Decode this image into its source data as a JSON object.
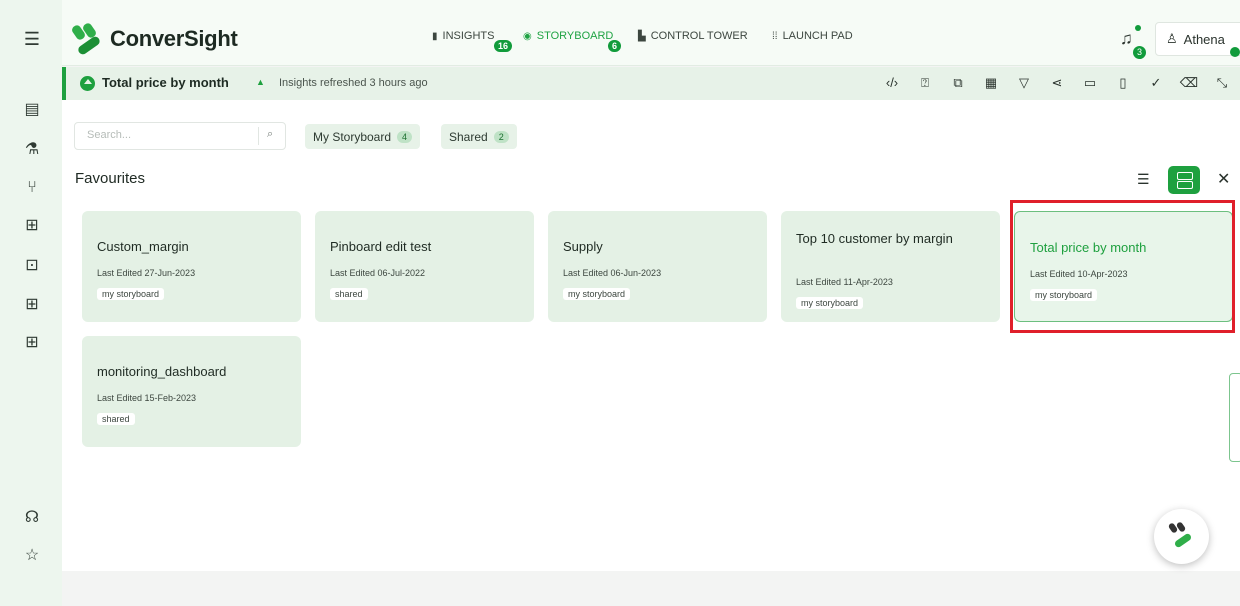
{
  "app": {
    "logo_text": "ConverSight"
  },
  "nav": {
    "items": [
      {
        "label": "INSIGHTS",
        "badge": "16",
        "icon": "bar-chart-icon"
      },
      {
        "label": "STORYBOARD",
        "badge": "6",
        "icon": "storyboard-icon"
      },
      {
        "label": "CONTROL TOWER",
        "icon": "tower-icon"
      },
      {
        "label": "LAUNCH PAD",
        "icon": "grid-icon"
      }
    ]
  },
  "notifications": {
    "count": "3"
  },
  "user": {
    "name": "Athena"
  },
  "storyboard": {
    "title": "Total price by month",
    "refresh": "Insights refreshed 3 hours ago",
    "tools": [
      "code-icon",
      "help-icon",
      "copy-icon",
      "layout-icon",
      "filter-icon",
      "share-icon",
      "calendar-icon",
      "document-icon",
      "check-icon",
      "delete-icon",
      "expand-icon"
    ]
  },
  "search": {
    "placeholder": "Search..."
  },
  "filters": [
    {
      "label": "My Storyboard",
      "count": "4"
    },
    {
      "label": "Shared",
      "count": "2"
    }
  ],
  "section": {
    "title": "Favourites"
  },
  "cards": [
    {
      "title": "Custom_margin",
      "edited": "Last Edited 27-Jun-2023",
      "tag": "my storyboard"
    },
    {
      "title": "Pinboard edit test",
      "edited": "Last Edited 06-Jul-2022",
      "tag": "shared"
    },
    {
      "title": "Supply",
      "edited": "Last Edited 06-Jun-2023",
      "tag": "my storyboard"
    },
    {
      "title": "Top 10 customer by margin",
      "edited": "Last Edited 11-Apr-2023",
      "tag": "my storyboard"
    },
    {
      "title": "Total price by month",
      "edited": "Last Edited 10-Apr-2023",
      "tag": "my storyboard"
    },
    {
      "title": "monitoring_dashboard",
      "edited": "Last Edited 15-Feb-2023",
      "tag": "shared"
    }
  ],
  "colors": {
    "accent": "#1ea03f",
    "highlight": "#e01f2a",
    "card_bg": "#e4f1e5"
  }
}
